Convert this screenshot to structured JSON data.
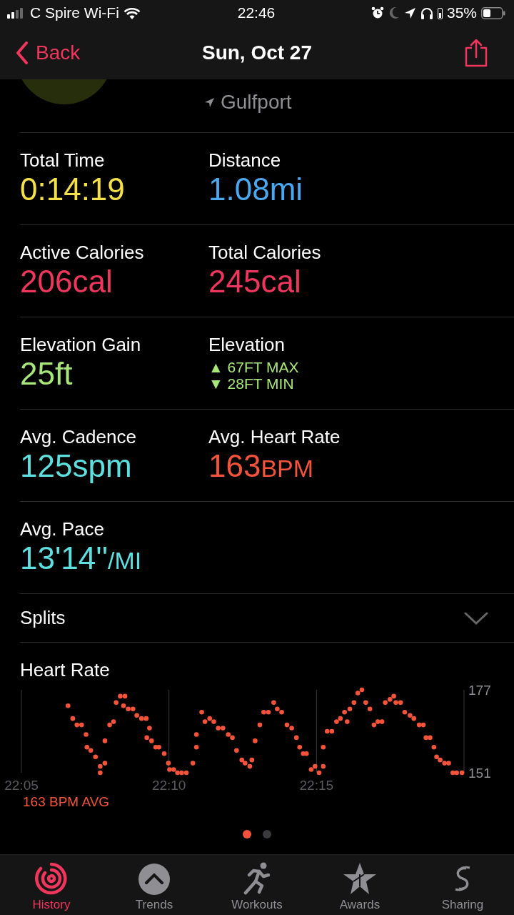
{
  "status_bar": {
    "carrier": "C Spire Wi-Fi",
    "time": "22:46",
    "battery": "35%"
  },
  "nav": {
    "back": "Back",
    "title": "Sun, Oct 27"
  },
  "header": {
    "location": "Gulfport"
  },
  "metrics": [
    [
      {
        "kind": "value",
        "label": "Total Time",
        "value": "0:14:19",
        "color": "#f5e04a"
      },
      {
        "kind": "value",
        "label": "Distance",
        "value": "1.08mi",
        "color": "#4aa8f0"
      }
    ],
    [
      {
        "kind": "value",
        "label": "Active Calories",
        "value": "206cal",
        "color": "#f0365c"
      },
      {
        "kind": "value",
        "label": "Total Calories",
        "value": "245cal",
        "color": "#f0365c"
      }
    ],
    [
      {
        "kind": "value",
        "label": "Elevation Gain",
        "value": "25ft",
        "color": "#a8e67a"
      },
      {
        "kind": "range",
        "label": "Elevation",
        "lines": [
          "▲ 67FT MAX",
          "▼ 28FT MIN"
        ],
        "color": "#a8e67a"
      }
    ],
    [
      {
        "kind": "value",
        "label": "Avg. Cadence",
        "value": "125spm",
        "color": "#5ee0e0"
      },
      {
        "kind": "value",
        "label": "Avg. Heart Rate",
        "value": "163",
        "unit": "BPM",
        "color": "#f5543a"
      }
    ],
    [
      {
        "kind": "value",
        "label": "Avg. Pace",
        "value": "13'14''",
        "unit": "/MI",
        "color": "#5ee0e0"
      }
    ]
  ],
  "splits": {
    "label": "Splits",
    "expanded": false
  },
  "heart_rate": {
    "title": "Heart Rate",
    "average": "163 BPM AVG",
    "chart_data": {
      "type": "scatter",
      "x": [
        1326.58,
        1326.74,
        1326.88,
        1327.04,
        1327.19,
        1327.22,
        1327.35,
        1327.51,
        1327.67,
        1327.83,
        1327.67,
        1327.83,
        1327.99,
        1328.12,
        1328.21,
        1328.35,
        1328.51,
        1328.46,
        1328.62,
        1328.78,
        1328.91,
        1329.07,
        1329.23,
        1329.34,
        1329.25,
        1329.41,
        1329.55,
        1329.66,
        1329.84,
        1329.98,
        1330.02,
        1330.16,
        1330.29,
        1330.43,
        1330.59,
        1330.81,
        1330.93,
        1330.93,
        1331.11,
        1331.22,
        1331.38,
        1331.52,
        1331.67,
        1331.83,
        1332.01,
        1332.15,
        1332.29,
        1332.47,
        1332.58,
        1332.74,
        1332.81,
        1332.92,
        1333.08,
        1333.21,
        1333.37,
        1333.55,
        1333.67,
        1333.82,
        1334.0,
        1334.16,
        1334.32,
        1334.43,
        1334.55,
        1334.66,
        1334.82,
        1334.95,
        1335.09,
        1335.23,
        1335.23,
        1335.36,
        1335.52,
        1335.68,
        1335.81,
        1335.95,
        1336.04,
        1336.13,
        1336.27,
        1336.4,
        1336.54,
        1336.67,
        1336.81,
        1336.95,
        1337.08,
        1337.22,
        1337.33,
        1337.49,
        1337.62,
        1337.69,
        1337.85,
        1337.99,
        1338.17,
        1338.3,
        1338.48,
        1338.62,
        1338.71,
        1338.85,
        1338.98,
        1339.07,
        1339.19,
        1339.34,
        1339.48,
        1339.62,
        1339.75,
        1339.93
      ],
      "series": [
        {
          "color": "#f5543a",
          "values": [
            172,
            168,
            166,
            166,
            163,
            159,
            158,
            156,
            153,
            154,
            151,
            161,
            166,
            167,
            173,
            175,
            175,
            172,
            171,
            171,
            169,
            168,
            168,
            165,
            162,
            161,
            159,
            159,
            157,
            154,
            152,
            152,
            151,
            151,
            151,
            154,
            159,
            163,
            170,
            167,
            168,
            167,
            165,
            165,
            163,
            162,
            158,
            155,
            154,
            153,
            155,
            161,
            166,
            170,
            170,
            173,
            171,
            170,
            166,
            165,
            162,
            159,
            157,
            157,
            152,
            153,
            151,
            153,
            159,
            164,
            164,
            167,
            168,
            170,
            167,
            171,
            173,
            176,
            177,
            173,
            171,
            166,
            167,
            167,
            173,
            174,
            175,
            173,
            173,
            170,
            169,
            168,
            166,
            166,
            162,
            162,
            159,
            156,
            155,
            154,
            154,
            151,
            151,
            151
          ]
        }
      ],
      "xlim": [
        1325,
        1340
      ],
      "ylim": [
        151,
        177
      ],
      "xticks": [
        {
          "value": 1325,
          "label": "22:05"
        },
        {
          "value": 1330,
          "label": "22:10"
        },
        {
          "value": 1335,
          "label": "22:15"
        }
      ],
      "yticks": [
        151,
        177
      ]
    }
  },
  "pages": [
    {
      "selected": true
    },
    {
      "selected": false
    }
  ],
  "tabs": [
    {
      "label": "History",
      "selected": true
    },
    {
      "label": "Trends",
      "selected": false
    },
    {
      "label": "Workouts",
      "selected": false
    },
    {
      "label": "Awards",
      "selected": false
    },
    {
      "label": "Sharing",
      "selected": false
    }
  ]
}
